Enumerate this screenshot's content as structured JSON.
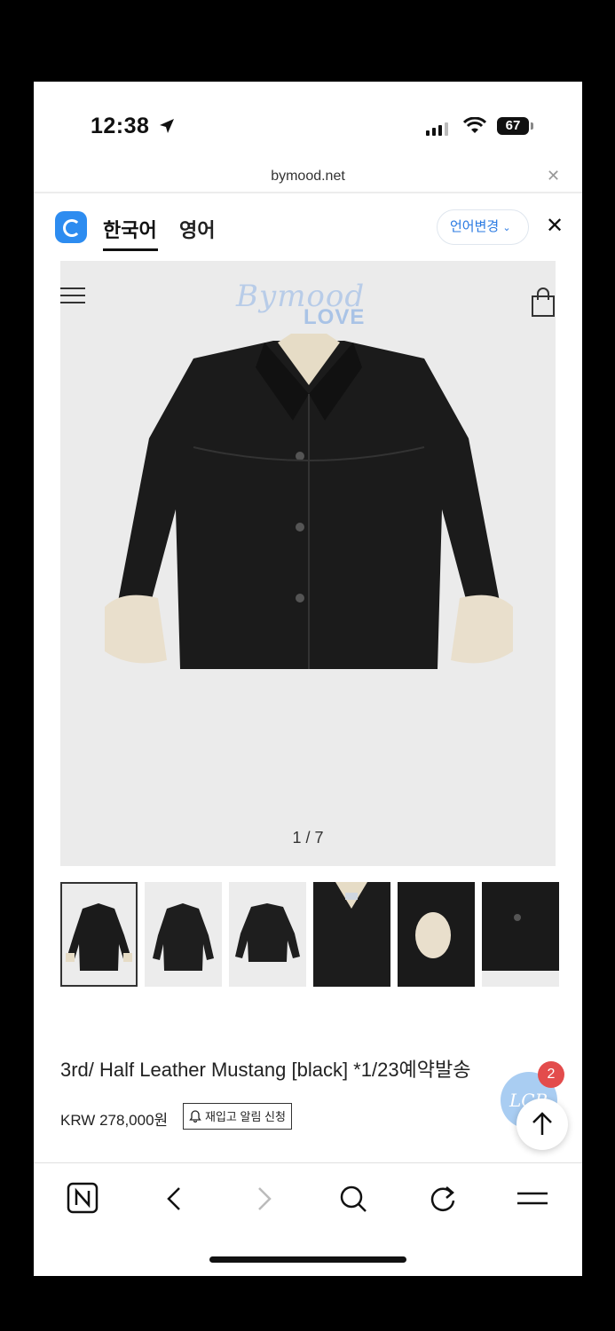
{
  "status_bar": {
    "time": "12:38",
    "battery": "67"
  },
  "url_bar": {
    "domain": "bymood.net"
  },
  "translate_bar": {
    "lang_korean": "한국어",
    "lang_english": "영어",
    "change_language": "언어변경"
  },
  "store": {
    "logo_script": "Bymood",
    "logo_word": "LOVE"
  },
  "gallery": {
    "pager": "1 / 7",
    "thumbnail_count": 6
  },
  "product": {
    "title": "3rd/ Half Leather Mustang [black] *1/23예약발송",
    "price": "KRW 278,000원",
    "restock_button": "재입고 알림 신청"
  },
  "floating": {
    "chat_badge": "2",
    "chat_logo": "LCP"
  },
  "colors": {
    "accent": "#2a7ae2",
    "badge": "#e34c4c",
    "gallery_bg": "#ebebeb"
  }
}
